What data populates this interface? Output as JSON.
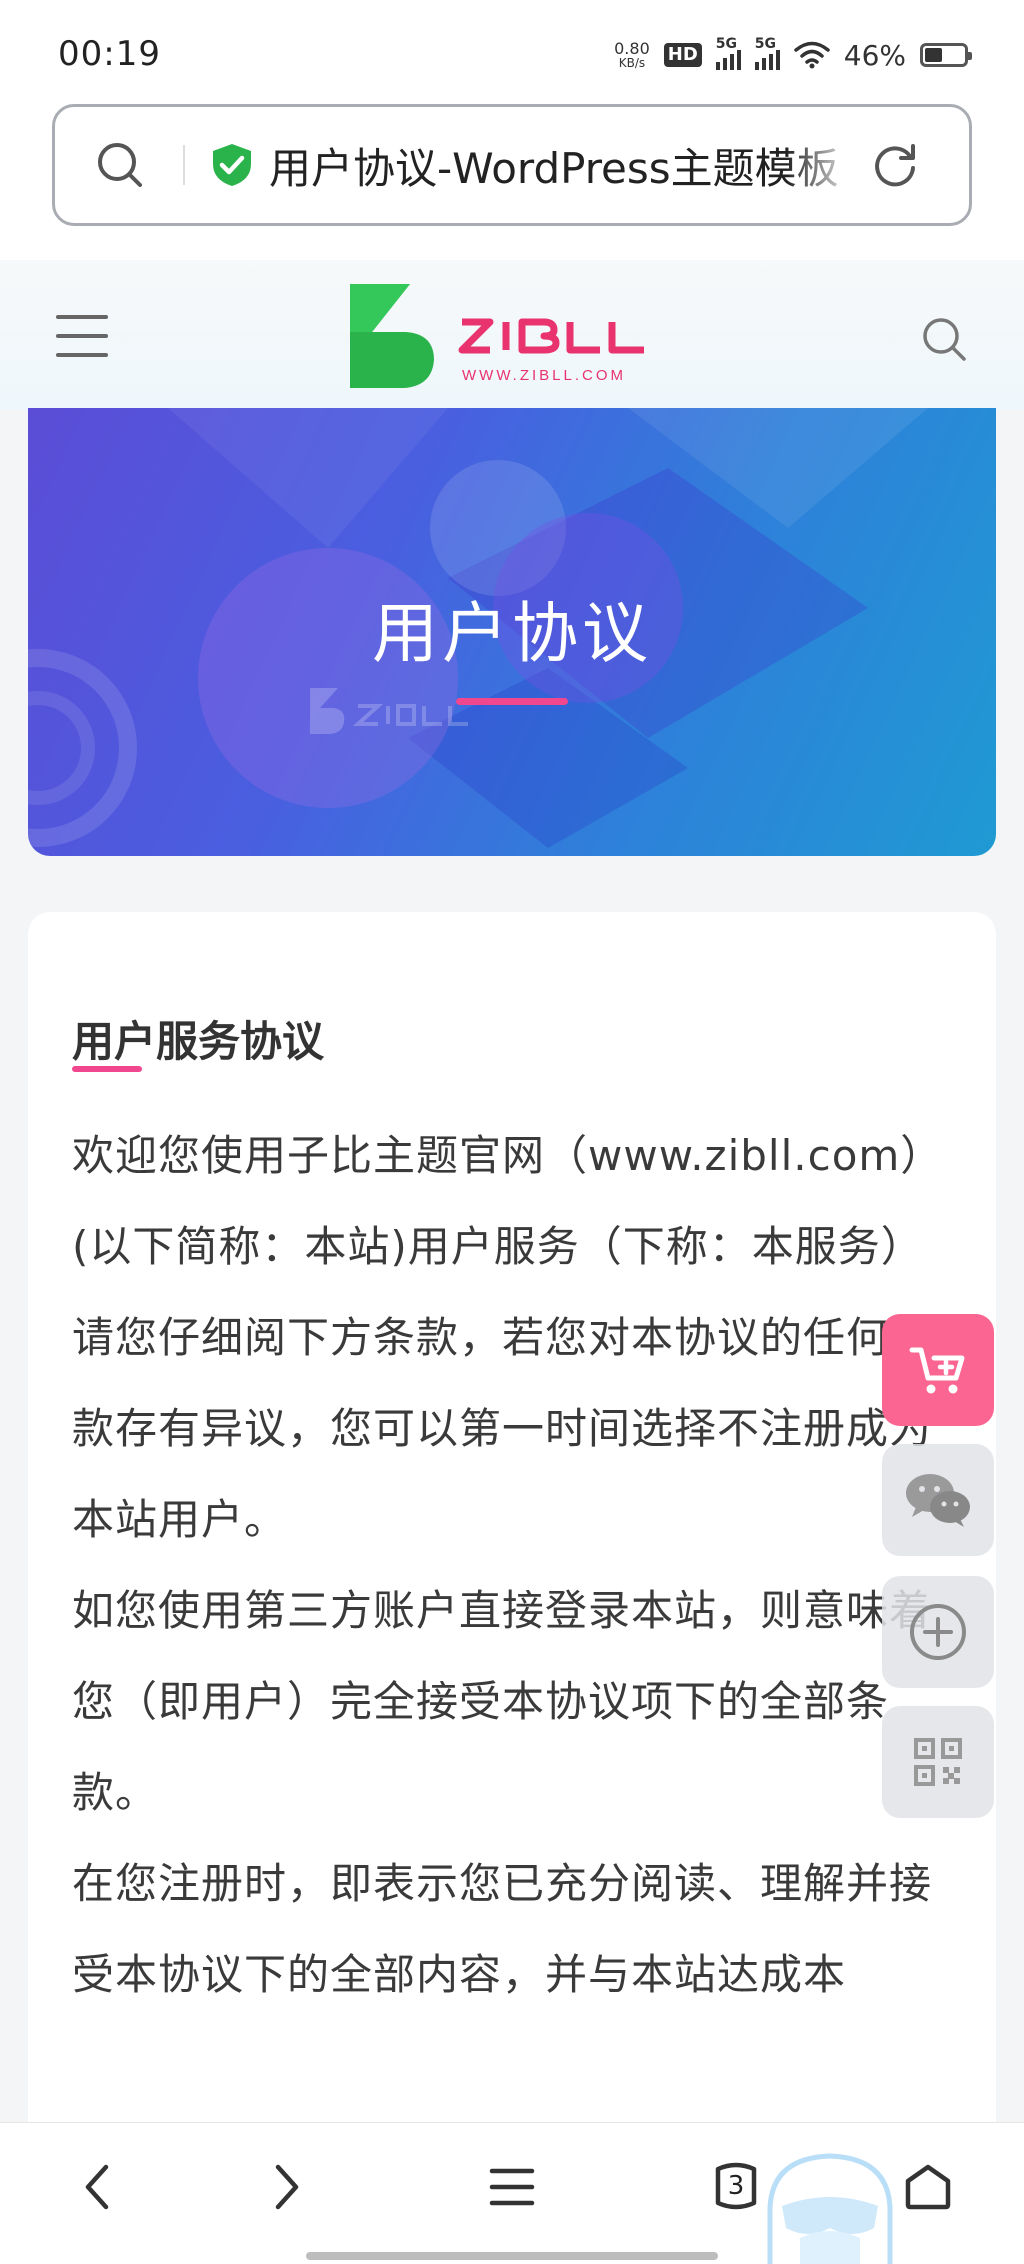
{
  "status_bar": {
    "time": "00:19",
    "net_speed_value": "0.80",
    "net_speed_unit": "KB/s",
    "hd_label": "HD",
    "sim1_label": "5G",
    "sim2_label": "5G",
    "battery_percent": "46%",
    "battery_level": 0.46
  },
  "address_bar": {
    "page_title": "用户协议-WordPress主题模板",
    "search_icon": "search-icon",
    "secure_icon": "shield-check-icon",
    "reload_icon": "reload-icon"
  },
  "site_header": {
    "menu_icon": "hamburger-icon",
    "logo_text": "ZIBLL",
    "logo_url_text": "WWW.ZIBLL.COM",
    "search_icon": "search-icon"
  },
  "banner": {
    "title": "用户协议"
  },
  "content": {
    "section_title": "用户服务协议",
    "paragraphs": [
      "欢迎您使用子比主题官网（www.zibll.com）(以下简称：本站)用户服务（下称：本服务）",
      "请您仔细阅下方条款，若您对本协议的任何条款存有异议，您可以第一时间选择不注册成为本站用户。",
      "如您使用第三方账户直接登录本站，则意味着您（即用户）完全接受本协议项下的全部条款。",
      "在您注册时，即表示您已充分阅读、理解并接受本协议下的全部内容，并与本站达成本"
    ]
  },
  "float_buttons": {
    "cart": "cart-plus-icon",
    "wechat": "wechat-icon",
    "add": "plus-circle-icon",
    "qr": "qrcode-icon",
    "cart_color": "#fb6592"
  },
  "bottom_nav": {
    "back_icon": "chevron-left-icon",
    "forward_icon": "chevron-right-icon",
    "menu_icon": "menu-icon",
    "tab_count": "3",
    "home_icon": "home-icon"
  },
  "colors": {
    "accent_pink": "#f0478f",
    "logo_green": "#2bb34b",
    "logo_pink": "#e8336e"
  }
}
